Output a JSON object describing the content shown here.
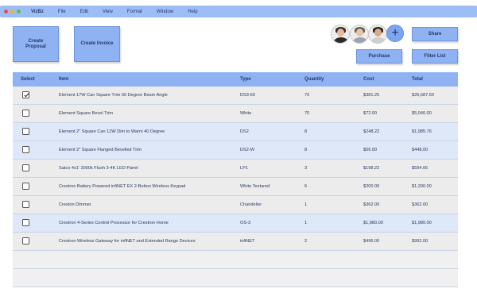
{
  "app": {
    "name": "VizBz",
    "menu": [
      "File",
      "Edit",
      "View",
      "Format",
      "Window",
      "Help"
    ]
  },
  "actions": {
    "create_proposal": "Create Proposal",
    "create_invoice": "Create Invoice",
    "share": "Share",
    "purchase": "Purchase",
    "filter_list": "Filter List",
    "add_collaborator": "+"
  },
  "table": {
    "headers": {
      "select": "Select",
      "item": "Item",
      "type": "Type",
      "quantity": "Quantity",
      "cost": "Cost",
      "total": "Total"
    },
    "rows": [
      {
        "selected": true,
        "item": "Element 17W Can Square Trim 60 Degree Beam Angle",
        "type": "DS3-60",
        "quantity": "70",
        "cost": "$381.25",
        "total": "$26,687.50"
      },
      {
        "selected": false,
        "item": "Element Square Bevel Trim",
        "type": "White",
        "quantity": "70",
        "cost": "$72.00",
        "total": "$5,040.00"
      },
      {
        "selected": false,
        "item": "Element 2\" Square Can 12W Dim to Warm 40 Degree",
        "type": "DS2",
        "quantity": "8",
        "cost": "$248.22",
        "total": "$1,985.76"
      },
      {
        "selected": false,
        "item": "Element 2\" Square Flanged Bevelled Trim",
        "type": "DS2-W",
        "quantity": "8",
        "cost": "$56.00",
        "total": "$448.00"
      },
      {
        "selected": false,
        "item": "Satco 4x1' 3000k Flush 3-4K LED Panel",
        "type": "LP1",
        "quantity": "3",
        "cost": "$198.22",
        "total": "$594.66"
      },
      {
        "selected": false,
        "item": "Crestron Battery Powered infiNET EX 2-Button Wireless Keypad",
        "type": "White Textured",
        "quantity": "6",
        "cost": "$200.00",
        "total": "$1,200.00"
      },
      {
        "selected": false,
        "item": "Creston Dimmer",
        "type": "Chandelier",
        "quantity": "1",
        "cost": "$362.00",
        "total": "$362.00"
      },
      {
        "selected": false,
        "item": "Crestron 4-Series Control Processor for Crestron Home",
        "type": "OS-3",
        "quantity": "1",
        "cost": "$1,980.00",
        "total": "$1,980.00"
      },
      {
        "selected": false,
        "item": "Crestron Wireless Gateway for infiNET and Extended Range Devices",
        "type": "infiNET",
        "quantity": "2",
        "cost": "$496.00",
        "total": "$992.00"
      }
    ]
  },
  "colors": {
    "accent": "#8fb2f3",
    "row_gray": "#ececec",
    "row_blue": "#dfe8f8"
  }
}
